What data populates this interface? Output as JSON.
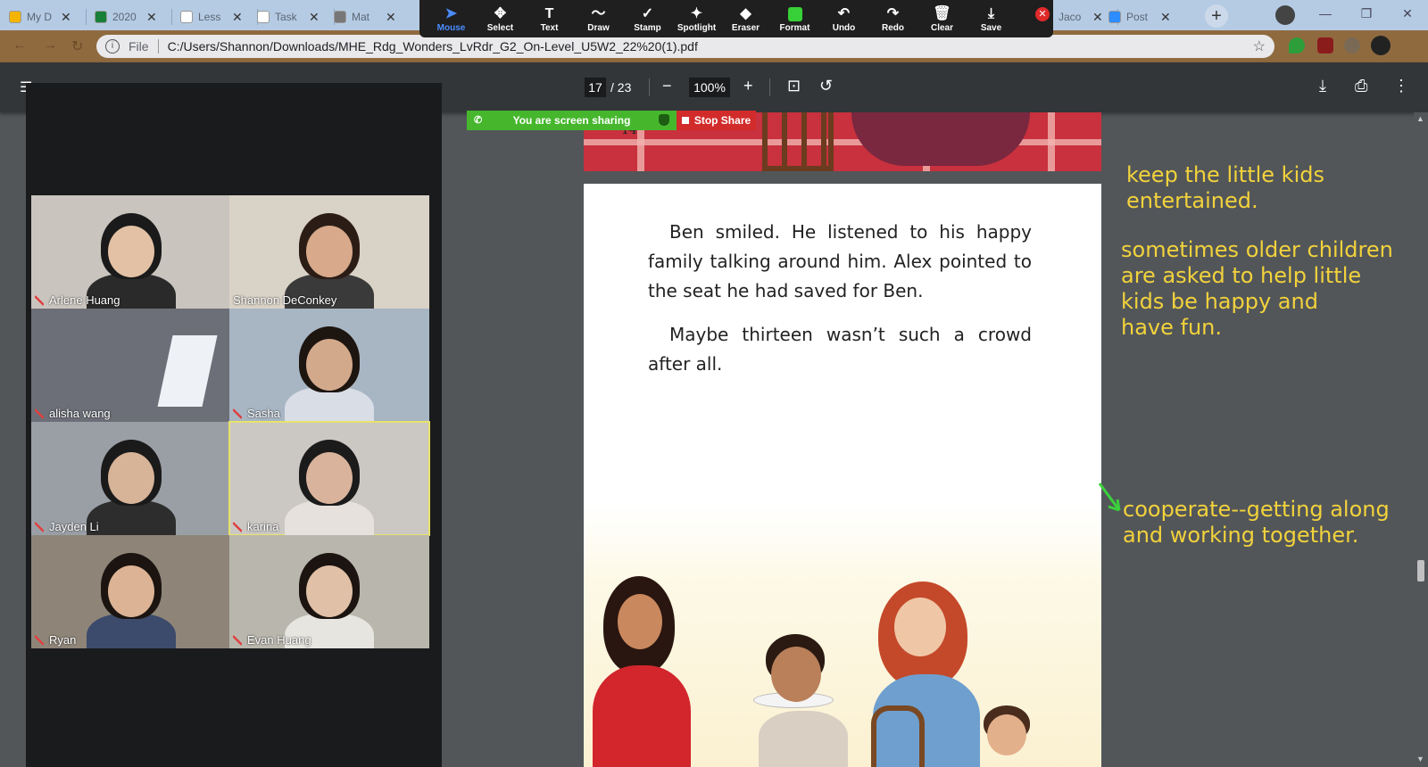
{
  "browser": {
    "tabs": [
      {
        "title": "My D",
        "color": "#f4b400"
      },
      {
        "title": "2020",
        "color": "#188038"
      },
      {
        "title": "Less",
        "color": "#ffffff"
      },
      {
        "title": "Task",
        "color": "#ffffff"
      },
      {
        "title": "Mat",
        "color": "#777777"
      },
      {
        "title": "Jaco",
        "color": "#4285f4"
      },
      {
        "title": "Post",
        "color": "#2d8cff"
      }
    ],
    "address_scheme": "File",
    "url": "C:/Users/Shannon/Downloads/MHE_Rdg_Wonders_LvRdr_G2_On-Level_U5W2_22%20(1).pdf"
  },
  "annotation_toolbar": {
    "tools": [
      {
        "label": "Mouse",
        "icon": "cursor-icon"
      },
      {
        "label": "Select",
        "icon": "move-icon"
      },
      {
        "label": "Text",
        "icon": "text-icon"
      },
      {
        "label": "Draw",
        "icon": "draw-icon"
      },
      {
        "label": "Stamp",
        "icon": "stamp-icon"
      },
      {
        "label": "Spotlight",
        "icon": "spotlight-icon"
      },
      {
        "label": "Eraser",
        "icon": "eraser-icon"
      },
      {
        "label": "Format",
        "icon": "format-icon"
      },
      {
        "label": "Undo",
        "icon": "undo-icon"
      },
      {
        "label": "Redo",
        "icon": "redo-icon"
      },
      {
        "label": "Clear",
        "icon": "trash-icon"
      },
      {
        "label": "Save",
        "icon": "save-icon"
      }
    ],
    "active_tool": "Mouse",
    "format_color": "#38d038"
  },
  "pdf_toolbar": {
    "current_page": "17",
    "total_pages": "/ 23",
    "zoom": "100%"
  },
  "screen_share": {
    "status": "You are screen sharing",
    "stop_label": "Stop Share"
  },
  "participants": [
    {
      "name": "Arlene Huang",
      "bg": "#c9c4bd",
      "skin": "#e2c1a4",
      "hair": "#1a1a1a",
      "shirt": "#2a2a2a"
    },
    {
      "name": "Shannon DeConkey",
      "bg": "#d9d2c6",
      "skin": "#d8a98a",
      "hair": "#2b1d16",
      "shirt": "#3a3a3a"
    },
    {
      "name": "alisha wang",
      "bg": "#6c6f78",
      "skin": "#6c6f78",
      "hair": "#6c6f78",
      "shirt": "#6c6f78"
    },
    {
      "name": "Sasha",
      "bg": "#a8b6c4",
      "skin": "#d3a98c",
      "hair": "#1d1510",
      "shirt": "#d9dde6"
    },
    {
      "name": "Jayden Li",
      "bg": "#9a9fa6",
      "skin": "#d7b398",
      "hair": "#1a1a1a",
      "shirt": "#2d2d2d"
    },
    {
      "name": "karina",
      "bg": "#cbc8c4",
      "skin": "#d9b39c",
      "hair": "#1b1b1b",
      "shirt": "#e6e1dc"
    },
    {
      "name": "Ryan",
      "bg": "#8e8578",
      "skin": "#dcb394",
      "hair": "#1b1410",
      "shirt": "#3c4a6b"
    },
    {
      "name": "Evan Huang",
      "bg": "#b9b7ad",
      "skin": "#e0c0a6",
      "hair": "#1b1410",
      "shirt": "#e7e5df"
    }
  ],
  "active_speaker": "karina",
  "pdf": {
    "page_number_printed": "14",
    "paragraphs": [
      "Ben smiled. He listened to his happy family talking around him. Alex pointed to the seat he had saved for Ben.",
      "Maybe thirteen wasn’t such a crowd after all."
    ]
  },
  "annotations": [
    "keep the little kids\nentertained.",
    "sometimes older children\nare asked to help little\nkids be happy and\nhave fun.",
    "cooperate--getting along\nand working together."
  ],
  "annotation_color": "#f2d23c"
}
